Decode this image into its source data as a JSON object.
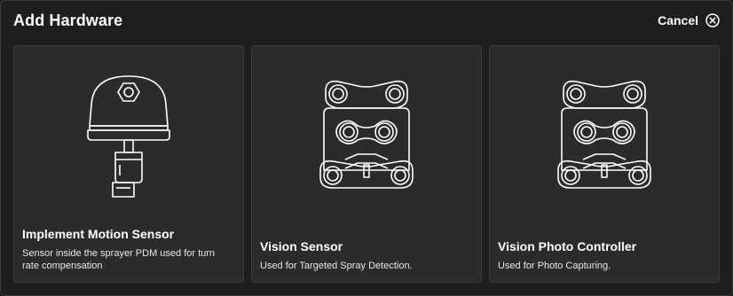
{
  "dialog": {
    "title": "Add Hardware",
    "cancel_label": "Cancel"
  },
  "cards": [
    {
      "title": "Implement Motion Sensor",
      "description": "Sensor inside the sprayer PDM used for turn rate compensation",
      "icon": "motion-sensor-icon"
    },
    {
      "title": "Vision Sensor",
      "description": "Used for Targeted Spray Detection.",
      "icon": "vision-bracket-icon"
    },
    {
      "title": "Vision Photo Controller",
      "description": "Used for Photo Capturing.",
      "icon": "vision-bracket-icon"
    }
  ],
  "colors": {
    "background": "#1e1e1e",
    "card": "#2b2b2b",
    "line": "#ffffff"
  }
}
